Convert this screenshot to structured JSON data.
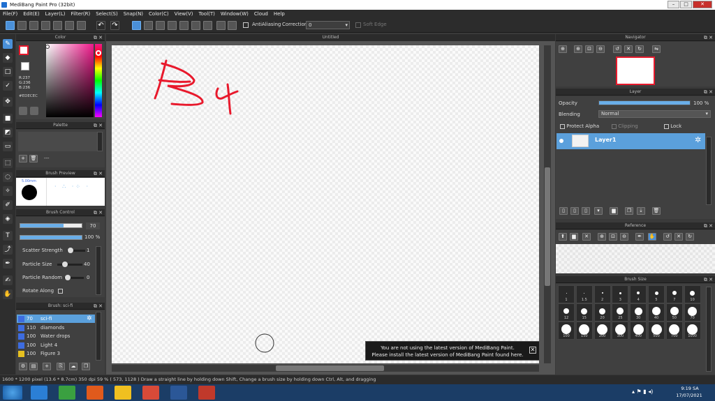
{
  "window": {
    "title": "MediBang Paint Pro (32bit)",
    "minimize": "–",
    "maximize": "□",
    "close": "✕"
  },
  "menu": [
    "File(F)",
    "Edit(E)",
    "Layer(L)",
    "Filter(R)",
    "Select(S)",
    "Snap(N)",
    "Color(C)",
    "View(V)",
    "Tool(T)",
    "Window(W)",
    "Cloud",
    "Help"
  ],
  "toolbar": {
    "antialias_label": "AntiAliasing",
    "correction_label": "Correction",
    "correction_value": "0",
    "softedge_label": "Soft Edge"
  },
  "color_panel": {
    "title": "Color",
    "r": "R:237",
    "g": "G:236",
    "b": "B:236",
    "hex": "#EDECEC",
    "primary": "#e8192c",
    "secondary": "#edecec"
  },
  "palette_panel": {
    "title": "Palette",
    "dash": "---"
  },
  "brush_preview": {
    "title": "Brush Preview",
    "size": "5.00mm"
  },
  "brush_control": {
    "title": "Brush Control",
    "size_value": "70",
    "opacity_value": "100 %",
    "scatter_label": "Scatter Strength",
    "scatter_value": "1",
    "particle_size_label": "Particle Size",
    "particle_size_value": "40",
    "particle_random_label": "Particle Random",
    "particle_random_value": "0",
    "rotate_label": "Rotate Along",
    "size_fill": 0.7,
    "opacity_fill": 1.0
  },
  "brush_list": {
    "title": "Brush: sci-fi",
    "items": [
      {
        "size": "70",
        "name": "sci-fi",
        "color": "#3d6ce0",
        "selected": true
      },
      {
        "size": "110",
        "name": "diamonds",
        "color": "#3d6ce0",
        "selected": false
      },
      {
        "size": "100",
        "name": "Water drops",
        "color": "#3d6ce0",
        "selected": false
      },
      {
        "size": "100",
        "name": "Light 4",
        "color": "#3d6ce0",
        "selected": false
      },
      {
        "size": "100",
        "name": "Figure 3",
        "color": "#e6c020",
        "selected": false
      }
    ]
  },
  "document": {
    "tab": "Untitled"
  },
  "notification": {
    "line1": "You are not using the latest version of MediBang Paint.",
    "line2": "Please install the latest version of MediBang Paint found here.",
    "close": "✕"
  },
  "navigator": {
    "title": "Navigator"
  },
  "layer_panel": {
    "title": "Layer",
    "opacity_label": "Opacity",
    "opacity_value": "100 %",
    "opacity_fill": 1.0,
    "blending_label": "Blending",
    "blending_value": "Normal",
    "protect_alpha": "Protect Alpha",
    "clipping": "Clipping",
    "lock": "Lock",
    "layer_name": "Layer1"
  },
  "reference": {
    "title": "Reference"
  },
  "brush_size": {
    "title": "Brush Size",
    "sizes": [
      "1",
      "1.5",
      "2",
      "3",
      "4",
      "5",
      "7",
      "10",
      "12",
      "15",
      "20",
      "25",
      "30",
      "40",
      "50",
      "70",
      "100",
      "150",
      "200",
      "300",
      "400",
      "500",
      "700",
      "1000"
    ]
  },
  "statusbar": {
    "text": "1600 * 1200 pixel  (13.6 * 8.7cm)  350 dpi  59 %  ( 573, 1128 )  Draw a straight line by holding down Shift, Change a brush size by holding down Ctrl, Alt, and dragging"
  },
  "taskbar": {
    "time": "9:19 SA",
    "date": "17/07/2021"
  },
  "colors": {
    "accent": "#4a90d9",
    "stroke": "#e8192c",
    "taskbar": "#1b3d66"
  }
}
